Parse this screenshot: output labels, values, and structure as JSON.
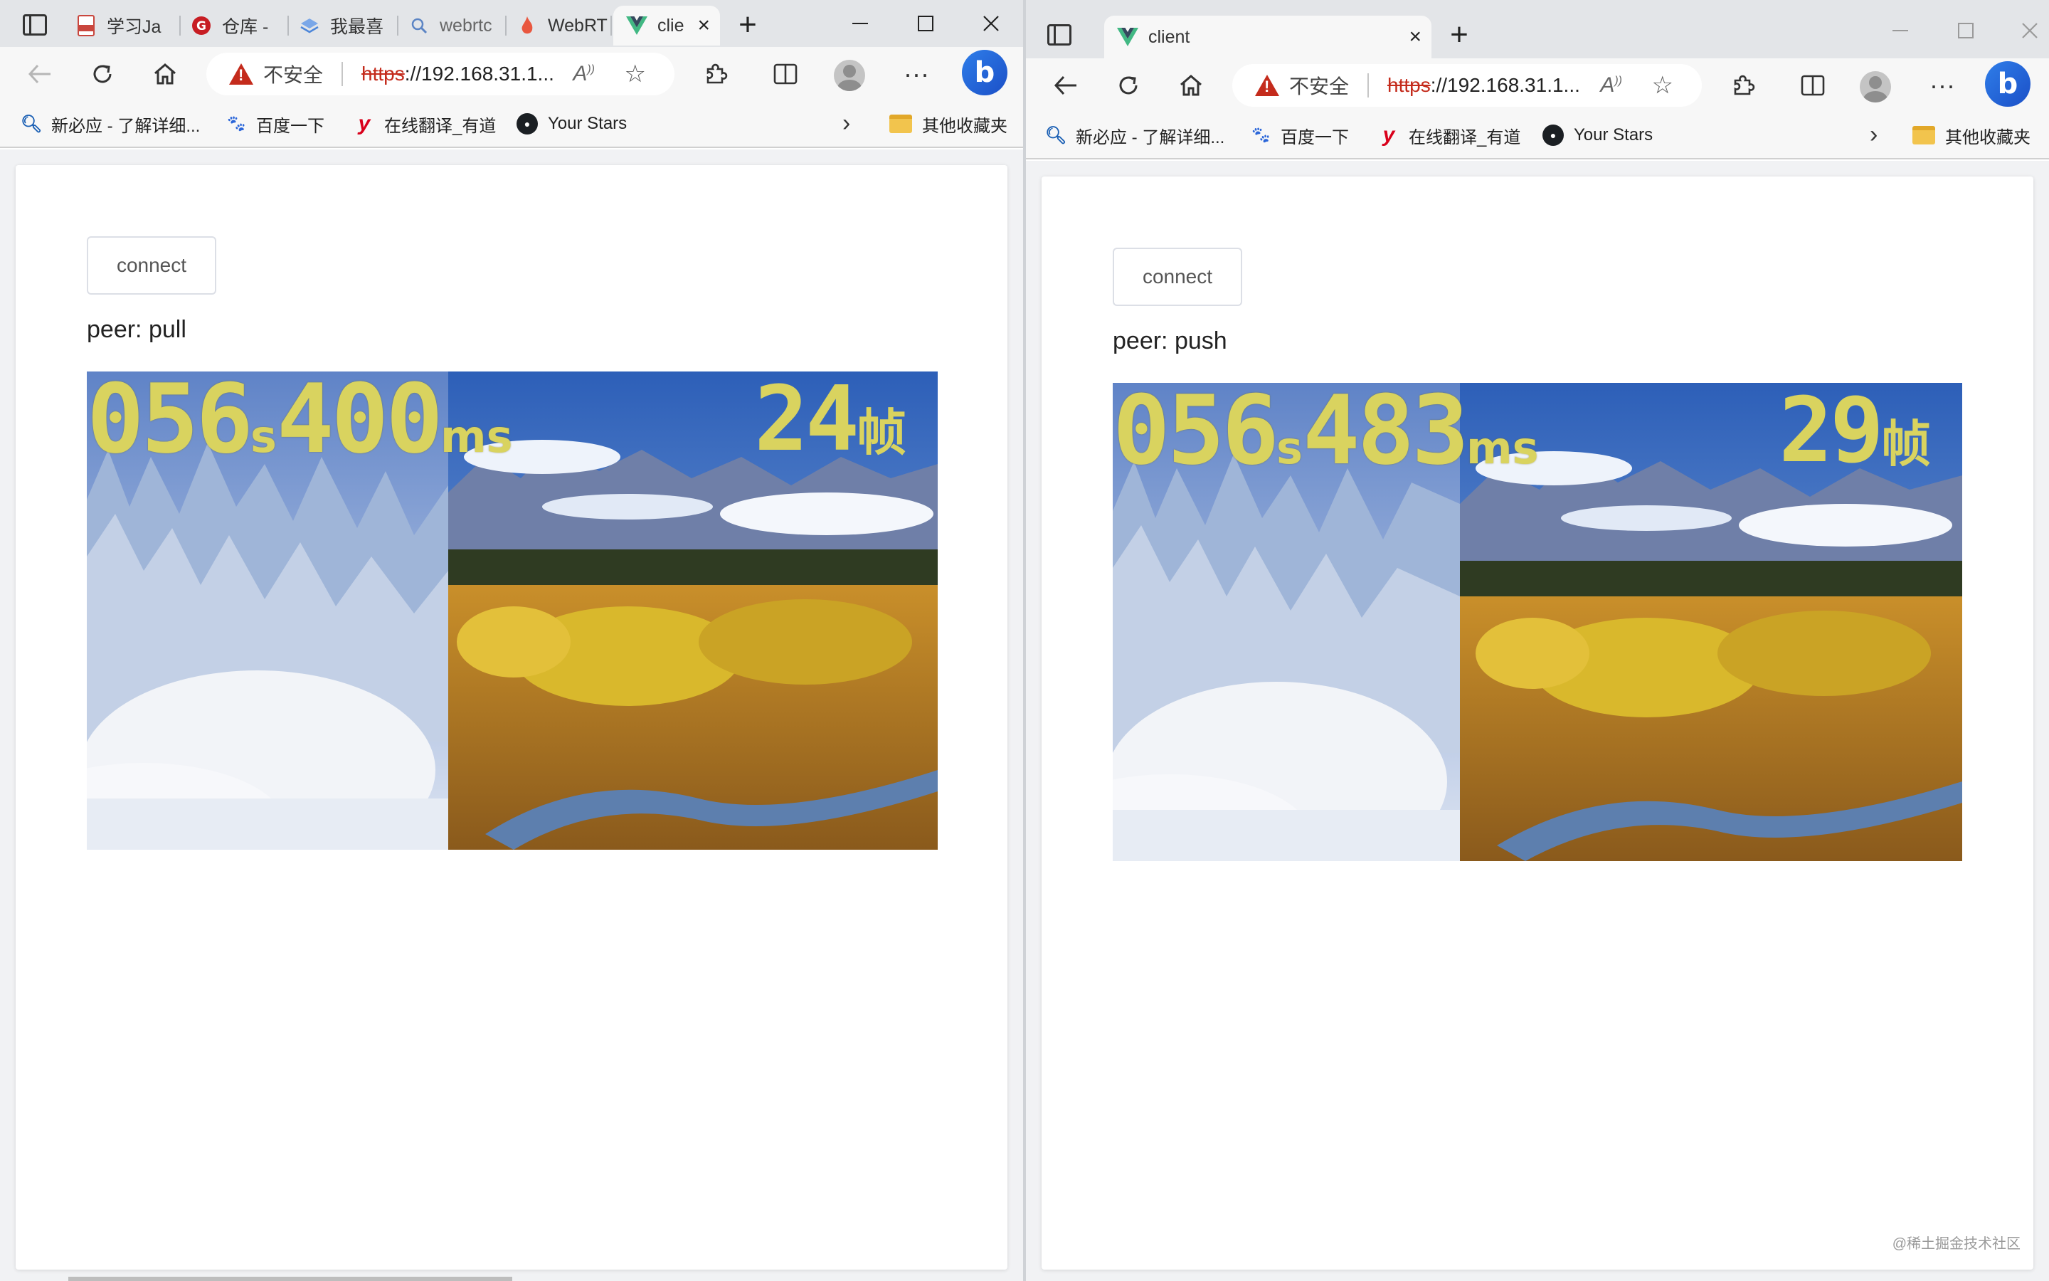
{
  "left_window": {
    "tabs": [
      {
        "label": "学习Ja",
        "icon": "pdf-icon"
      },
      {
        "label": "仓库 - ",
        "icon": "gitee-icon"
      },
      {
        "label": "我最喜",
        "icon": "layers-icon"
      },
      {
        "label": "webrtc",
        "icon": "search-icon"
      },
      {
        "label": "WebRT",
        "icon": "flame-icon"
      }
    ],
    "active_tab": {
      "label": "clie",
      "icon": "vue-icon"
    },
    "address": {
      "insecure_label": "不安全",
      "scheme": "https",
      "rest": "://192.168.31.1..."
    },
    "favorites": [
      {
        "label": "新必应 - 了解详细...",
        "icon": "search-icon"
      },
      {
        "label": "百度一下",
        "icon": "baidu-icon"
      },
      {
        "label": "在线翻译_有道",
        "icon": "youdao-icon"
      },
      {
        "label": "Your Stars",
        "icon": "github-icon"
      }
    ],
    "other_favorites": "其他收藏夹",
    "page": {
      "connect_label": "connect",
      "peer_label": "peer: pull",
      "video": {
        "seconds": "056",
        "seconds_unit": "s",
        "millis": "400",
        "millis_unit": "ms",
        "fps": "24",
        "fps_unit": "帧"
      }
    }
  },
  "right_window": {
    "active_tab": {
      "label": "client",
      "icon": "vue-icon"
    },
    "address": {
      "insecure_label": "不安全",
      "scheme": "https",
      "rest": "://192.168.31.1..."
    },
    "favorites": [
      {
        "label": "新必应 - 了解详细...",
        "icon": "search-icon"
      },
      {
        "label": "百度一下",
        "icon": "baidu-icon"
      },
      {
        "label": "在线翻译_有道",
        "icon": "youdao-icon"
      },
      {
        "label": "Your Stars",
        "icon": "github-icon"
      }
    ],
    "other_favorites": "其他收藏夹",
    "page": {
      "connect_label": "connect",
      "peer_label": "peer: push",
      "video": {
        "seconds": "056",
        "seconds_unit": "s",
        "millis": "483",
        "millis_unit": "ms",
        "fps": "29",
        "fps_unit": "帧"
      }
    },
    "watermark": "@稀土掘金技术社区"
  },
  "colors": {
    "accent_blue": "#1b4fc7",
    "insecure_red": "#c42b1c",
    "overlay_yellow": "#d9d35f",
    "vue_green": "#41b883"
  }
}
